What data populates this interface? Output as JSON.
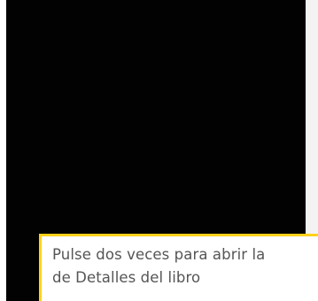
{
  "tooltip": {
    "line1": "Pulse dos veces para abrir la",
    "line2": "de Detalles del libro"
  },
  "colors": {
    "panel_background": "#020202",
    "tooltip_border": "#ffd21a",
    "tooltip_text": "#555555",
    "right_strip": "#f3f3f3"
  }
}
